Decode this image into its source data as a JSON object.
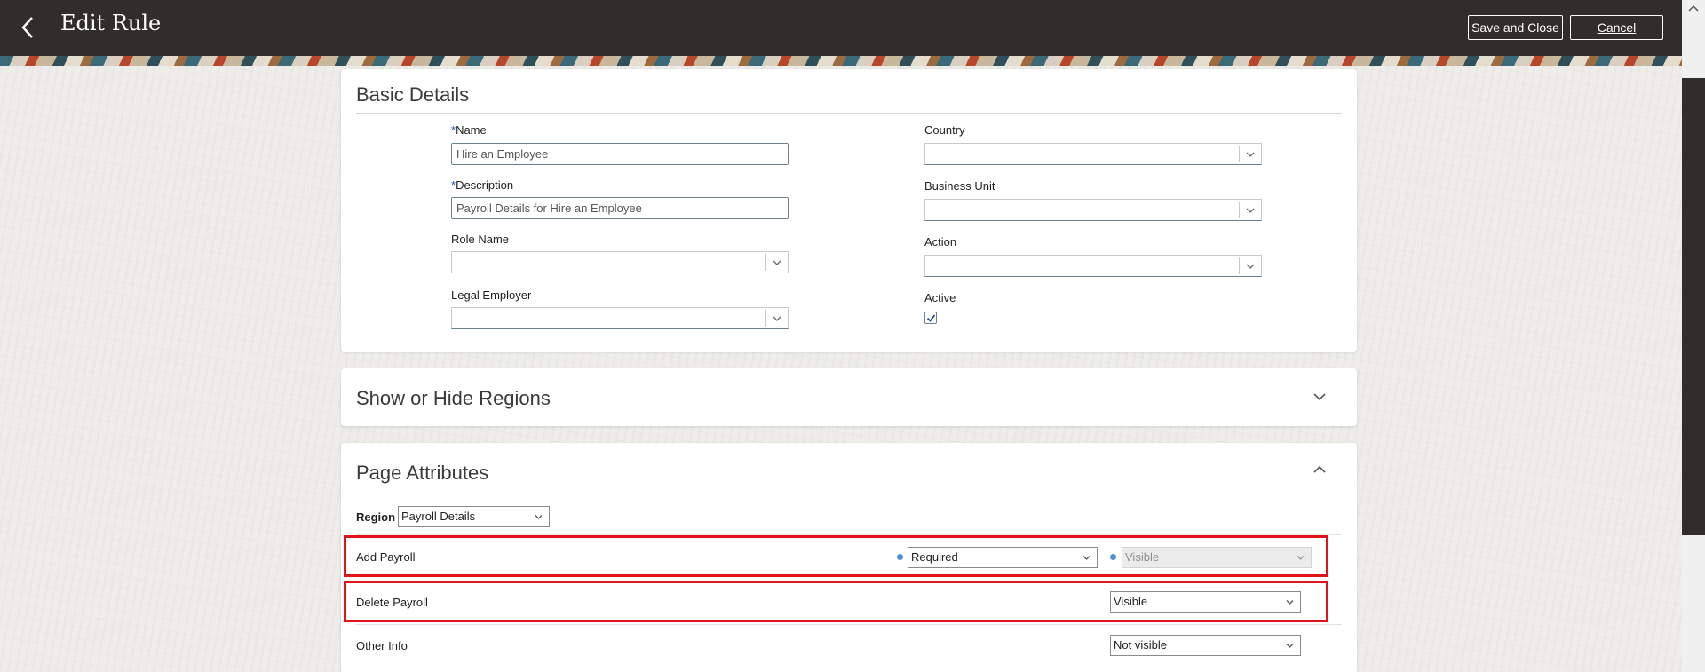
{
  "header": {
    "title": "Edit Rule",
    "save_label": "Save and Close",
    "cancel_label": "Cancel",
    "back_icon": "chevron-left-icon"
  },
  "basic_details": {
    "title": "Basic Details",
    "name": {
      "label": "Name",
      "required": "*",
      "value": "Hire an Employee"
    },
    "description": {
      "label": "Description",
      "required": "*",
      "value": "Payroll Details for Hire an Employee"
    },
    "role_name": {
      "label": "Role Name",
      "value": ""
    },
    "legal_employer": {
      "label": "Legal Employer",
      "value": ""
    },
    "country": {
      "label": "Country",
      "value": ""
    },
    "business_unit": {
      "label": "Business Unit",
      "value": ""
    },
    "action": {
      "label": "Action",
      "value": ""
    },
    "active": {
      "label": "Active",
      "checked": true
    }
  },
  "show_hide_regions": {
    "title": "Show or Hide Regions",
    "expanded": false
  },
  "page_attributes": {
    "title": "Page Attributes",
    "expanded": true,
    "region_label": "Region",
    "region_value": "Payroll Details",
    "rows": [
      {
        "label": "Add Payroll",
        "required_value": "Required",
        "visibility_value": "Visible",
        "visibility_disabled": true,
        "highlighted": true
      },
      {
        "label": "Delete Payroll",
        "visibility_value": "Visible",
        "highlighted": true
      },
      {
        "label": "Other Info",
        "visibility_value": "Not visible",
        "highlighted": false
      }
    ]
  },
  "colors": {
    "header_bg": "#312d2a",
    "highlight": "#e0141d",
    "required_dot": "#4a8fd8"
  }
}
